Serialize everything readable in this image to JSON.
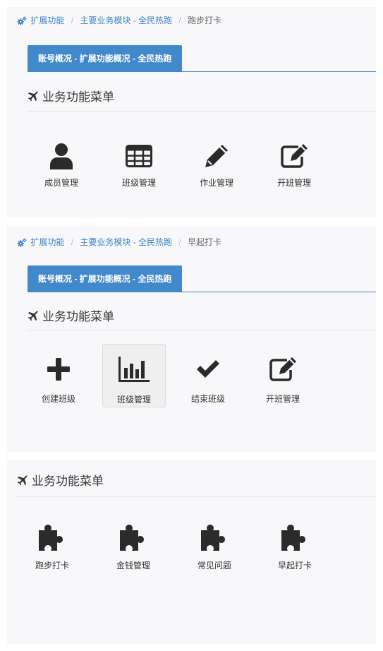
{
  "panels": [
    {
      "breadcrumb": [
        "扩展功能",
        "主要业务模块 - 全民热跑",
        "跑步打卡"
      ],
      "tab_label": "账号概况 - 扩展功能概况 - 全民热跑",
      "section_title": "业务功能菜单",
      "tiles": [
        {
          "label": "成员管理",
          "icon": "user-icon"
        },
        {
          "label": "班级管理",
          "icon": "table-grid-icon"
        },
        {
          "label": "作业管理",
          "icon": "pencil-icon"
        },
        {
          "label": "开班管理",
          "icon": "edit-square-icon"
        }
      ]
    },
    {
      "breadcrumb": [
        "扩展功能",
        "主要业务模块 - 全民热跑",
        "早起打卡"
      ],
      "tab_label": "账号概况 - 扩展功能概况 - 全民热跑",
      "section_title": "业务功能菜单",
      "tiles": [
        {
          "label": "创建班级",
          "icon": "plus-icon"
        },
        {
          "label": "班级管理",
          "icon": "bar-chart-icon",
          "active": true
        },
        {
          "label": "结束班级",
          "icon": "check-icon"
        },
        {
          "label": "开班管理",
          "icon": "edit-square-icon"
        }
      ]
    },
    {
      "section_title": "业务功能菜单",
      "tiles": [
        {
          "label": "跑步打卡",
          "icon": "puzzle-icon"
        },
        {
          "label": "金钱管理",
          "icon": "puzzle-icon"
        },
        {
          "label": "常见问题",
          "icon": "puzzle-icon"
        },
        {
          "label": "早起打卡",
          "icon": "puzzle-icon"
        }
      ]
    }
  ],
  "colors": {
    "link": "#3f84c5",
    "tab": "#4289cc",
    "icon": "#2b2b2b"
  }
}
